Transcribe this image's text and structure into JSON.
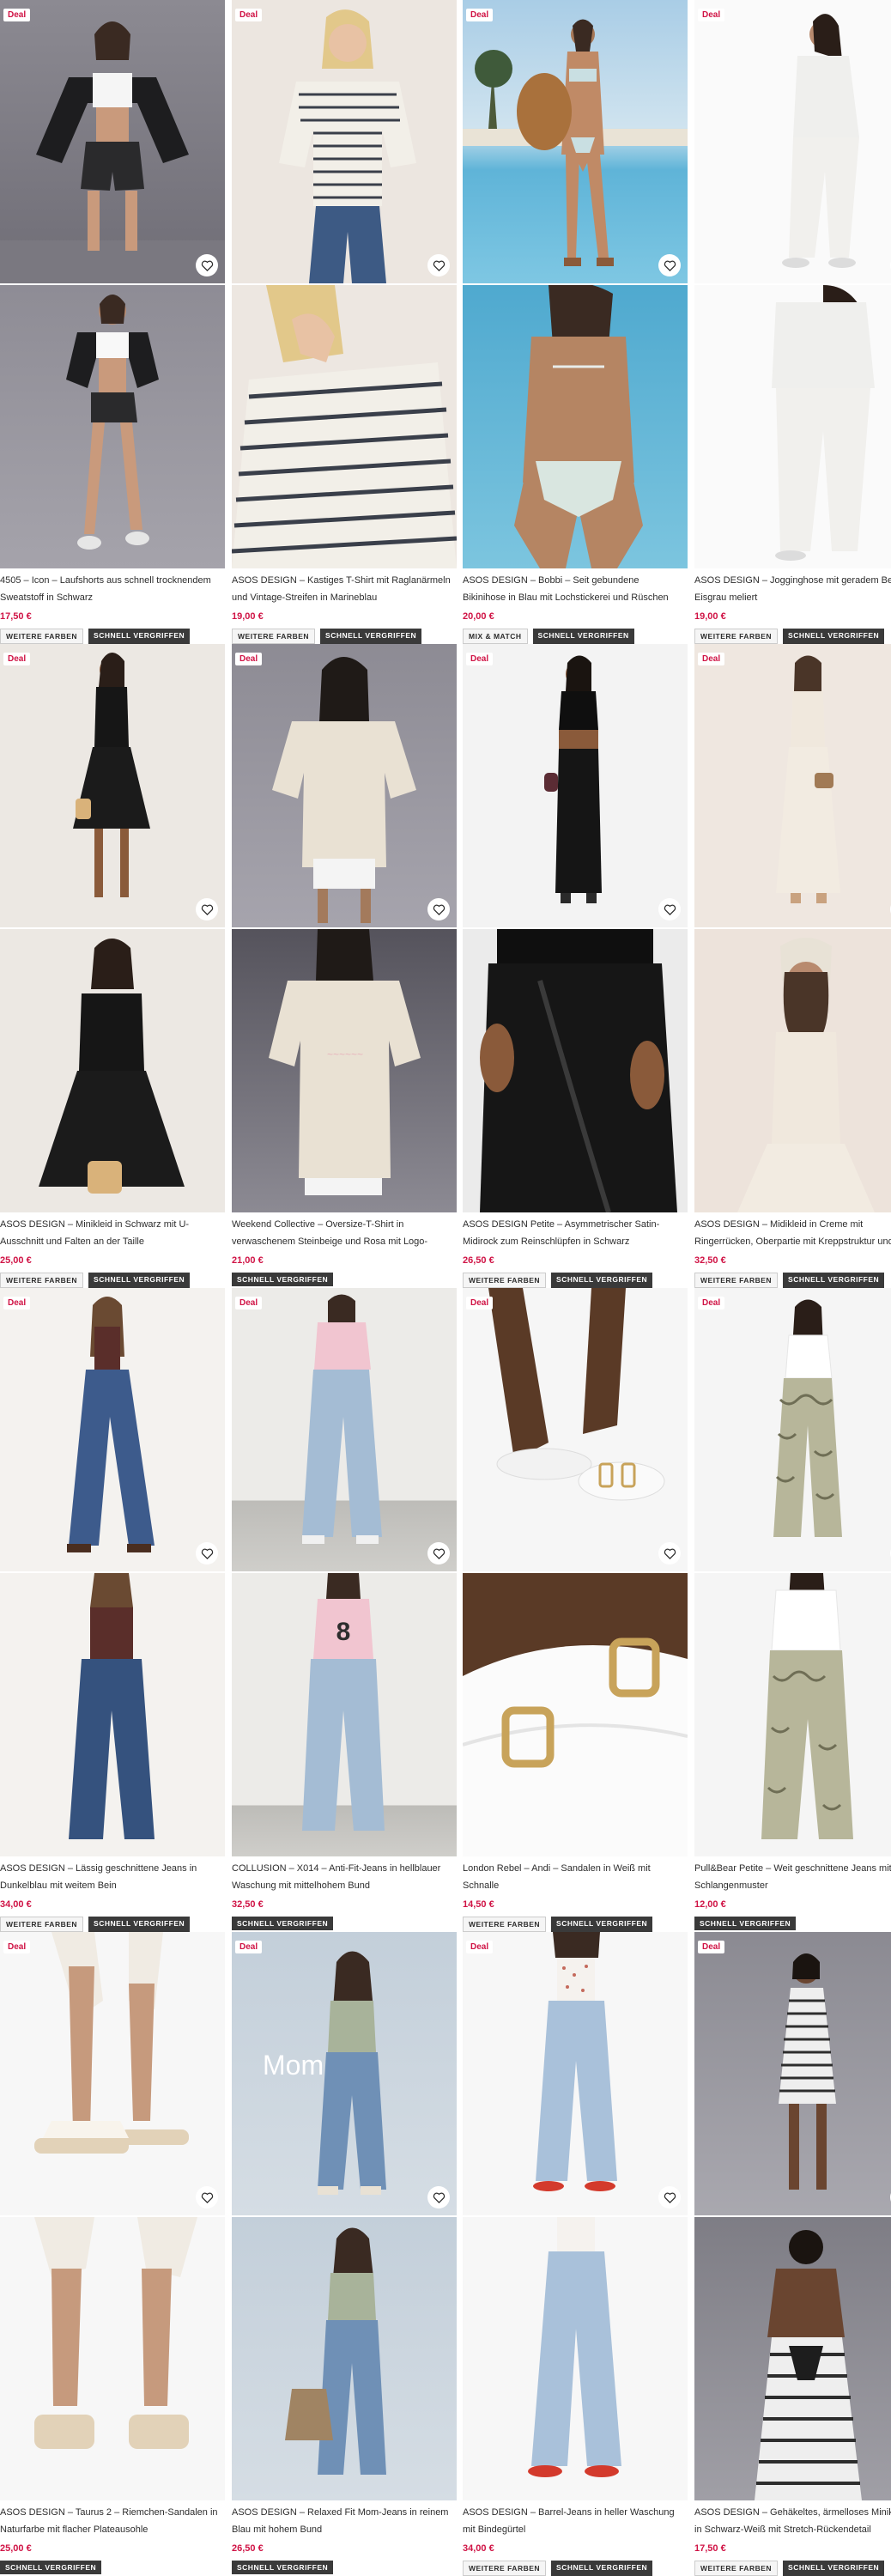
{
  "badges": {
    "deal": "Deal"
  },
  "tags": {
    "more_colors": "WEITERE FARBEN",
    "quick_buy": "SCHNELL VERGRIFFEN",
    "mix_match": "MIX & MATCH"
  },
  "products": [
    {
      "title": "4505 – Icon – Laufshorts aus schnell trocknendem Sweatstoff in Schwarz",
      "price": "17,50 €",
      "deal": true,
      "tags": [
        "WEITERE FARBEN",
        "SCHNELL VERGRIFFEN"
      ]
    },
    {
      "title": "ASOS DESIGN – Kastiges T-Shirt mit Raglanärmeln und Vintage-Streifen in Marineblau",
      "price": "19,00 €",
      "deal": true,
      "tags": [
        "WEITERE FARBEN",
        "SCHNELL VERGRIFFEN"
      ]
    },
    {
      "title": "ASOS DESIGN – Bobbi – Seit gebundene Bikinihose in Blau mit Lochstickerei und Rüschen",
      "price": "20,00 €",
      "deal": true,
      "tags": [
        "MIX & MATCH",
        "SCHNELL VERGRIFFEN"
      ]
    },
    {
      "title": "ASOS DESIGN – Jogginghose mit geradem Bein in Eisgrau meliert",
      "price": "19,00 €",
      "deal": true,
      "tags": [
        "WEITERE FARBEN",
        "SCHNELL VERGRIFFEN"
      ]
    },
    {
      "title": "ASOS DESIGN – Minikleid in Schwarz mit U-Ausschnitt und Falten an der Taille",
      "price": "25,00 €",
      "deal": true,
      "tags": [
        "WEITERE FARBEN",
        "SCHNELL VERGRIFFEN"
      ]
    },
    {
      "title": "Weekend Collective – Oversize-T-Shirt in verwaschenem Steinbeige und Rosa mit Logo-Print…",
      "price": "21,00 €",
      "deal": true,
      "tags": [
        "SCHNELL VERGRIFFEN"
      ]
    },
    {
      "title": "ASOS DESIGN Petite – Asymmetrischer Satin-Midirock zum Reinschlüpfen in Schwarz",
      "price": "26,50 €",
      "deal": true,
      "tags": [
        "WEITERE FARBEN",
        "SCHNELL VERGRIFFEN"
      ]
    },
    {
      "title": "ASOS DESIGN – Midikleid in Creme mit Ringerrücken, Oberpartie mit Kreppstruktur und…",
      "price": "32,50 €",
      "deal": true,
      "tags": [
        "WEITERE FARBEN",
        "SCHNELL VERGRIFFEN"
      ]
    },
    {
      "title": "ASOS DESIGN – Lässig geschnittene Jeans in Dunkelblau mit weitem Bein",
      "price": "34,00 €",
      "deal": true,
      "tags": [
        "WEITERE FARBEN",
        "SCHNELL VERGRIFFEN"
      ]
    },
    {
      "title": "COLLUSION – X014 – Anti-Fit-Jeans in hellblauer Waschung mit mittelhohem Bund",
      "price": "32,50 €",
      "deal": true,
      "tags": [
        "SCHNELL VERGRIFFEN"
      ]
    },
    {
      "title": "London Rebel – Andi – Sandalen in Weiß mit Schnalle",
      "price": "14,50 €",
      "deal": true,
      "tags": [
        "WEITERE FARBEN",
        "SCHNELL VERGRIFFEN"
      ]
    },
    {
      "title": "Pull&Bear Petite – Weit geschnittene Jeans mit Schlangenmuster",
      "price": "12,00 €",
      "deal": true,
      "tags": [
        "SCHNELL VERGRIFFEN"
      ]
    },
    {
      "title": "ASOS DESIGN – Taurus 2 – Riemchen-Sandalen in Naturfarbe mit flacher Plateausohle",
      "price": "25,00 €",
      "deal": true,
      "tags": [
        "SCHNELL VERGRIFFEN"
      ]
    },
    {
      "title": "ASOS DESIGN – Relaxed Fit Mom-Jeans in reinem Blau mit hohem Bund",
      "price": "26,50 €",
      "deal": true,
      "tags": [
        "SCHNELL VERGRIFFEN"
      ]
    },
    {
      "title": "ASOS DESIGN – Barrel-Jeans in heller Waschung mit Bindegürtel",
      "price": "34,00 €",
      "deal": true,
      "tags": [
        "WEITERE FARBEN",
        "SCHNELL VERGRIFFEN"
      ]
    },
    {
      "title": "ASOS DESIGN – Gehäkeltes, ärmelloses Minikleid in Schwarz-Weiß mit Stretch-Rückendetail",
      "price": "17,50 €",
      "deal": true,
      "tags": [
        "WEITERE FARBEN",
        "SCHNELL VERGRIFFEN"
      ]
    }
  ],
  "overlay_text": {
    "mom": "Mom"
  }
}
